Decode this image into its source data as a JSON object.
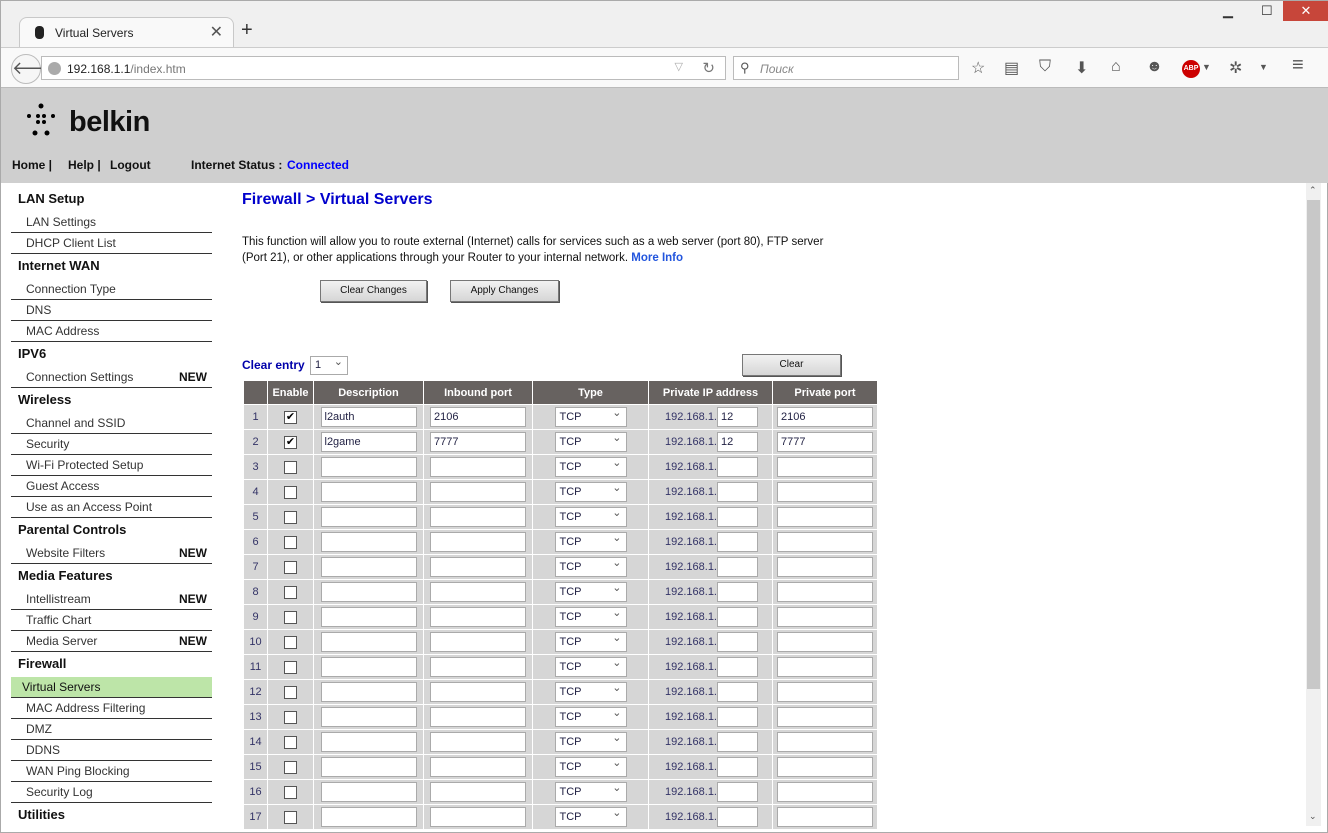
{
  "browser": {
    "tab_title": "Virtual Servers",
    "url_host": "192.168.1.1",
    "url_path": "/index.htm",
    "search_placeholder": "Поиск",
    "abp": "ABP"
  },
  "header": {
    "logo": "belkin",
    "nav": [
      "Home |",
      "Help |",
      "Logout"
    ],
    "status_label": "Internet Status :",
    "status_value": "Connected",
    "status_color": "#0000ff"
  },
  "sidebar": [
    {
      "section": "LAN Setup",
      "items": [
        {
          "label": "LAN Settings"
        },
        {
          "label": "DHCP Client List"
        }
      ]
    },
    {
      "section": "Internet WAN",
      "items": [
        {
          "label": "Connection Type"
        },
        {
          "label": "DNS"
        },
        {
          "label": "MAC Address"
        }
      ]
    },
    {
      "section": "IPV6",
      "items": [
        {
          "label": "Connection Settings",
          "badge": "NEW"
        }
      ]
    },
    {
      "section": "Wireless",
      "items": [
        {
          "label": "Channel and SSID"
        },
        {
          "label": "Security"
        },
        {
          "label": "Wi-Fi Protected Setup"
        },
        {
          "label": "Guest Access"
        },
        {
          "label": "Use as an Access Point"
        }
      ]
    },
    {
      "section": "Parental Controls",
      "items": [
        {
          "label": "Website Filters",
          "badge": "NEW"
        }
      ]
    },
    {
      "section": "Media Features",
      "items": [
        {
          "label": "Intellistream",
          "badge": "NEW"
        },
        {
          "label": "Traffic Chart"
        },
        {
          "label": "Media Server",
          "badge": "NEW"
        }
      ]
    },
    {
      "section": "Firewall",
      "items": [
        {
          "label": "Virtual Servers",
          "active": true
        },
        {
          "label": "MAC Address Filtering"
        },
        {
          "label": "DMZ"
        },
        {
          "label": "DDNS"
        },
        {
          "label": "WAN Ping Blocking"
        },
        {
          "label": "Security Log"
        }
      ]
    },
    {
      "section": "Utilities",
      "items": []
    }
  ],
  "main": {
    "title": "Firewall > Virtual Servers",
    "description": "This function will allow you to route external (Internet) calls for services such as a web server (port 80), FTP server (Port 21), or other applications through your Router to your internal network.",
    "more_info": "More Info",
    "clear_changes": "Clear Changes",
    "apply_changes": "Apply Changes",
    "clear_entry_label": "Clear entry",
    "clear_entry_value": "1",
    "clear_button": "Clear",
    "columns": [
      "",
      "Enable",
      "Description",
      "Inbound port",
      "Type",
      "Private IP address",
      "Private port"
    ],
    "ip_prefix": "192.168.1.",
    "rows": [
      {
        "n": "1",
        "enabled": true,
        "desc": "l2auth",
        "inbound": "2106",
        "type": "TCP",
        "ip": "12",
        "port": "2106"
      },
      {
        "n": "2",
        "enabled": true,
        "desc": "l2game",
        "inbound": "7777",
        "type": "TCP",
        "ip": "12",
        "port": "7777"
      },
      {
        "n": "3",
        "enabled": false,
        "desc": "",
        "inbound": "",
        "type": "TCP",
        "ip": "",
        "port": ""
      },
      {
        "n": "4",
        "enabled": false,
        "desc": "",
        "inbound": "",
        "type": "TCP",
        "ip": "",
        "port": ""
      },
      {
        "n": "5",
        "enabled": false,
        "desc": "",
        "inbound": "",
        "type": "TCP",
        "ip": "",
        "port": ""
      },
      {
        "n": "6",
        "enabled": false,
        "desc": "",
        "inbound": "",
        "type": "TCP",
        "ip": "",
        "port": ""
      },
      {
        "n": "7",
        "enabled": false,
        "desc": "",
        "inbound": "",
        "type": "TCP",
        "ip": "",
        "port": ""
      },
      {
        "n": "8",
        "enabled": false,
        "desc": "",
        "inbound": "",
        "type": "TCP",
        "ip": "",
        "port": ""
      },
      {
        "n": "9",
        "enabled": false,
        "desc": "",
        "inbound": "",
        "type": "TCP",
        "ip": "",
        "port": ""
      },
      {
        "n": "10",
        "enabled": false,
        "desc": "",
        "inbound": "",
        "type": "TCP",
        "ip": "",
        "port": ""
      },
      {
        "n": "11",
        "enabled": false,
        "desc": "",
        "inbound": "",
        "type": "TCP",
        "ip": "",
        "port": ""
      },
      {
        "n": "12",
        "enabled": false,
        "desc": "",
        "inbound": "",
        "type": "TCP",
        "ip": "",
        "port": ""
      },
      {
        "n": "13",
        "enabled": false,
        "desc": "",
        "inbound": "",
        "type": "TCP",
        "ip": "",
        "port": ""
      },
      {
        "n": "14",
        "enabled": false,
        "desc": "",
        "inbound": "",
        "type": "TCP",
        "ip": "",
        "port": ""
      },
      {
        "n": "15",
        "enabled": false,
        "desc": "",
        "inbound": "",
        "type": "TCP",
        "ip": "",
        "port": ""
      },
      {
        "n": "16",
        "enabled": false,
        "desc": "",
        "inbound": "",
        "type": "TCP",
        "ip": "",
        "port": ""
      },
      {
        "n": "17",
        "enabled": false,
        "desc": "",
        "inbound": "",
        "type": "TCP",
        "ip": "",
        "port": ""
      }
    ]
  }
}
